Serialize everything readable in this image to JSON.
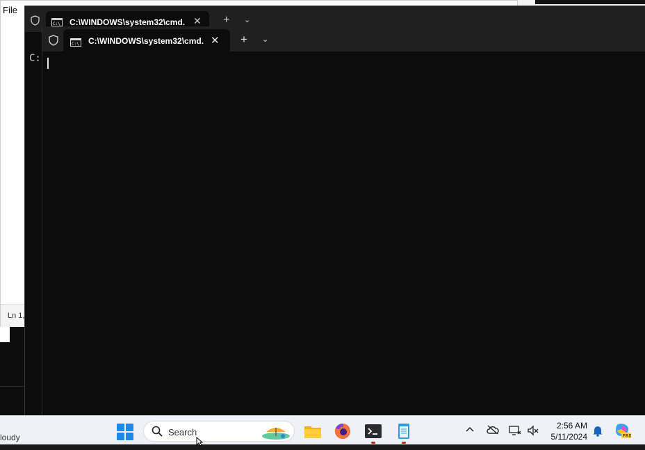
{
  "notepad": {
    "menu_file": "File",
    "status_pos": "Ln 1,"
  },
  "terminal_back": {
    "tab_title": "C:\\WINDOWS\\system32\\cmd.",
    "prompt": "C:"
  },
  "terminal_front": {
    "tab_title": "C:\\WINDOWS\\system32\\cmd.",
    "close": "✕",
    "new_tab": "+",
    "dropdown": "⌄"
  },
  "taskbar": {
    "weather_text": "loudy",
    "search_placeholder": "Search",
    "time": "2:56 AM",
    "date": "5/11/2024"
  },
  "colors": {
    "terminal_bg": "#0c0c0c",
    "tabbar_bg": "#202020",
    "taskbar_bg": "#eef1f6",
    "accent": "#1e88e5"
  }
}
